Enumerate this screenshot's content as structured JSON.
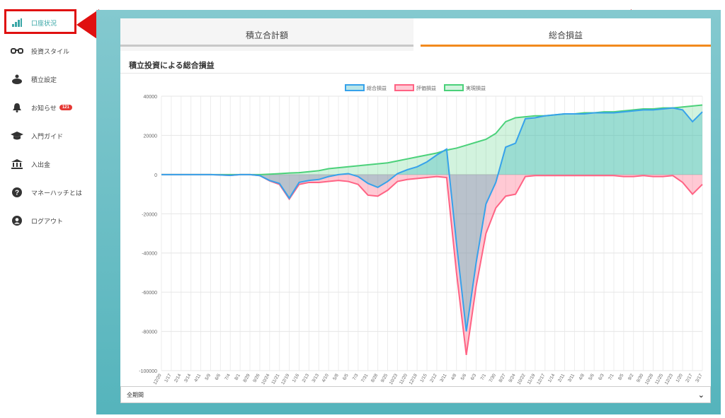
{
  "sidebar": {
    "items": [
      {
        "label": "口座状況",
        "icon": "bar-chart-icon",
        "active": true
      },
      {
        "label": "投資スタイル",
        "icon": "glasses-icon"
      },
      {
        "label": "積立設定",
        "icon": "piggy-bank-icon"
      },
      {
        "label": "お知らせ",
        "icon": "bell-icon",
        "badge": "121"
      },
      {
        "label": "入門ガイド",
        "icon": "graduation-cap-icon"
      },
      {
        "label": "入出金",
        "icon": "bank-icon"
      },
      {
        "label": "マネーハッチとは",
        "icon": "question-circle-icon"
      },
      {
        "label": "ログアウト",
        "icon": "user-circle-icon"
      }
    ]
  },
  "tabs": [
    {
      "label": "積立合計額"
    },
    {
      "label": "総合損益",
      "active": true
    }
  ],
  "card": {
    "title": "積立投資による総合損益"
  },
  "period_select": {
    "value": "全期間"
  },
  "colors": {
    "accent": "#f28a1d",
    "teal": "#55b4bc",
    "annotation": "#e01010",
    "total": "#36a2eb",
    "unrealized": "#ff6384",
    "realized": "#4bd17a"
  },
  "chart_data": {
    "type": "line",
    "legend": [
      "総合損益",
      "評価損益",
      "実現損益"
    ],
    "legend_position": "top",
    "grid": true,
    "ylim": [
      -100000,
      40000
    ],
    "yticks": [
      40000,
      20000,
      0,
      -20000,
      -40000,
      -60000,
      -80000,
      -100000
    ],
    "xtick_labels": [
      "12/20",
      "1/17",
      "2/14",
      "3/14",
      "4/11",
      "5/9",
      "6/6",
      "7/4",
      "8/1",
      "8/29",
      "9/26",
      "10/24",
      "11/21",
      "12/19",
      "1/16",
      "2/13",
      "3/13",
      "4/10",
      "5/8",
      "6/5",
      "7/3",
      "7/31",
      "8/28",
      "9/25",
      "10/23",
      "11/20",
      "12/18",
      "1/15",
      "2/12",
      "3/11",
      "4/8",
      "5/6",
      "6/3",
      "7/1",
      "7/30",
      "8/27",
      "9/24",
      "10/22",
      "11/19",
      "12/17",
      "1/14",
      "2/11",
      "3/11",
      "4/8",
      "5/6",
      "6/3",
      "7/1",
      "8/5",
      "9/2",
      "9/30",
      "10/28",
      "11/25",
      "12/23",
      "1/20",
      "2/17",
      "3/17"
    ],
    "series": [
      {
        "name": "総合損益",
        "values": [
          0,
          0,
          0,
          0,
          0,
          0,
          -200,
          -400,
          0,
          0,
          -500,
          -3000,
          -4500,
          -12000,
          -4000,
          -3000,
          -2500,
          -1000,
          0,
          500,
          -1000,
          -4500,
          -6500,
          -3500,
          500,
          2500,
          4000,
          6500,
          10000,
          13000,
          -35000,
          -80000,
          -45000,
          -15000,
          -4000,
          14000,
          16000,
          28500,
          29000,
          30000,
          30500,
          31000,
          31000,
          31000,
          31500,
          31500,
          31500,
          32000,
          32500,
          33000,
          33000,
          33500,
          34000,
          33000,
          27000,
          32000
        ]
      },
      {
        "name": "評価損益",
        "values": [
          0,
          0,
          0,
          0,
          0,
          0,
          -200,
          -400,
          0,
          0,
          -500,
          -3200,
          -5000,
          -12500,
          -5000,
          -4000,
          -4000,
          -3500,
          -3000,
          -3500,
          -5000,
          -10500,
          -11000,
          -8000,
          -3500,
          -2500,
          -2000,
          -1500,
          -1000,
          -1500,
          -50000,
          -92000,
          -57000,
          -30000,
          -17000,
          -11000,
          -10000,
          -1000,
          -500,
          -500,
          -500,
          -500,
          -500,
          -500,
          -500,
          -500,
          -500,
          -1000,
          -1000,
          -500,
          -1000,
          -1000,
          -500,
          -4000,
          -10000,
          -5000
        ]
      },
      {
        "name": "実現損益",
        "values": [
          0,
          0,
          0,
          0,
          0,
          0,
          0,
          0,
          0,
          0,
          0,
          200,
          500,
          800,
          1000,
          1500,
          2000,
          3000,
          3500,
          4000,
          4500,
          5000,
          5500,
          6000,
          7000,
          8000,
          9000,
          10000,
          11000,
          12500,
          13500,
          15000,
          16500,
          18000,
          21000,
          27000,
          29000,
          29500,
          30000,
          30000,
          30500,
          31000,
          31000,
          31500,
          31500,
          32000,
          32000,
          32500,
          33000,
          33500,
          33500,
          34000,
          34000,
          34500,
          35000,
          35500
        ]
      }
    ]
  }
}
